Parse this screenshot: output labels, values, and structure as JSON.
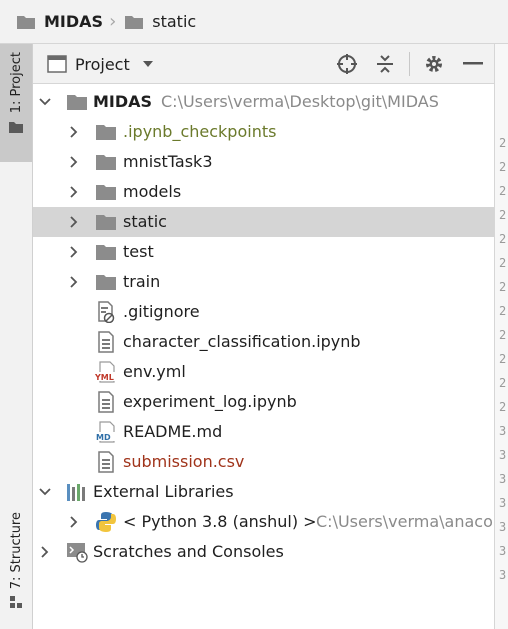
{
  "breadcrumb": {
    "items": [
      {
        "label": "MIDAS",
        "icon": "folder-icon"
      },
      {
        "label": "static",
        "icon": "folder-icon"
      }
    ]
  },
  "tool_stripe": {
    "project_tab": "1: Project",
    "structure_tab": "7: Structure"
  },
  "panel": {
    "title": "Project",
    "actions": [
      "locate-icon",
      "collapse-all-icon",
      "gear-icon",
      "hide-icon"
    ]
  },
  "tree": {
    "root": {
      "name": "MIDAS",
      "path": "C:\\Users\\verma\\Desktop\\git\\MIDAS"
    },
    "folders": [
      {
        "name": ".ipynb_checkpoints",
        "color": "#6b7a2c"
      },
      {
        "name": "mnistTask3",
        "color": "#1f1f1f"
      },
      {
        "name": "models",
        "color": "#1f1f1f"
      },
      {
        "name": "static",
        "color": "#1f1f1f",
        "selected": true
      },
      {
        "name": "test",
        "color": "#1f1f1f"
      },
      {
        "name": "train",
        "color": "#1f1f1f"
      }
    ],
    "files": [
      {
        "name": ".gitignore",
        "icon": "gitignore-file-icon",
        "color": "#1f1f1f"
      },
      {
        "name": "character_classification.ipynb",
        "icon": "text-file-icon",
        "color": "#1f1f1f"
      },
      {
        "name": "env.yml",
        "icon": "yaml-file-icon",
        "color": "#1f1f1f"
      },
      {
        "name": "experiment_log.ipynb",
        "icon": "text-file-icon",
        "color": "#1f1f1f"
      },
      {
        "name": "README.md",
        "icon": "markdown-file-icon",
        "color": "#1f1f1f"
      },
      {
        "name": "submission.csv",
        "icon": "text-file-icon",
        "color": "#a0341b"
      }
    ],
    "external_libraries": "External Libraries",
    "python_sdk": {
      "name": "< Python 3.8 (anshul) >",
      "path": "C:\\Users\\verma\\anaco"
    },
    "scratches": "Scratches and Consoles"
  },
  "colors": {
    "selected_row": "#d5d5d5",
    "folder_icon": "#8c8c8c",
    "modified_folder": "#6b7a2c",
    "unversioned_file": "#a0341b",
    "path_gray": "#8a8a8a"
  },
  "editor_gutter_digits": [
    "2",
    "2",
    "2",
    "2",
    "2",
    "2",
    "2",
    "2",
    "2",
    "2",
    "2",
    "2",
    "3",
    "3",
    "3",
    "3",
    "3",
    "3",
    "3"
  ]
}
